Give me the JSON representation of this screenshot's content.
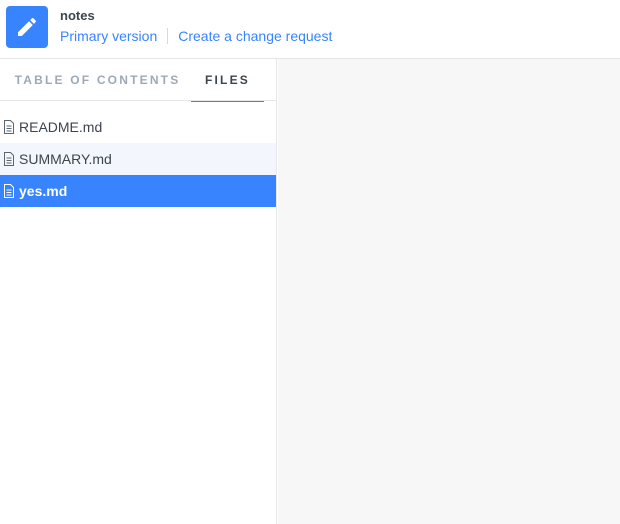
{
  "header": {
    "icon": "pencil-icon",
    "title": "notes",
    "primary_version_label": "Primary version",
    "change_request_label": "Create a change request"
  },
  "sidebar": {
    "tabs": [
      {
        "label": "TABLE OF CONTENTS",
        "active": false
      },
      {
        "label": "FILES",
        "active": true
      }
    ],
    "files": [
      {
        "name": "README.md",
        "icon": "file-icon",
        "state": "normal"
      },
      {
        "name": "SUMMARY.md",
        "icon": "file-icon",
        "state": "hover"
      },
      {
        "name": "yes.md",
        "icon": "file-icon",
        "state": "selected"
      }
    ]
  },
  "colors": {
    "accent": "#3884ff",
    "text": "#3b454e",
    "muted": "#9daab6",
    "hover_bg": "#f3f6fd",
    "content_bg": "#f7f7f8"
  }
}
